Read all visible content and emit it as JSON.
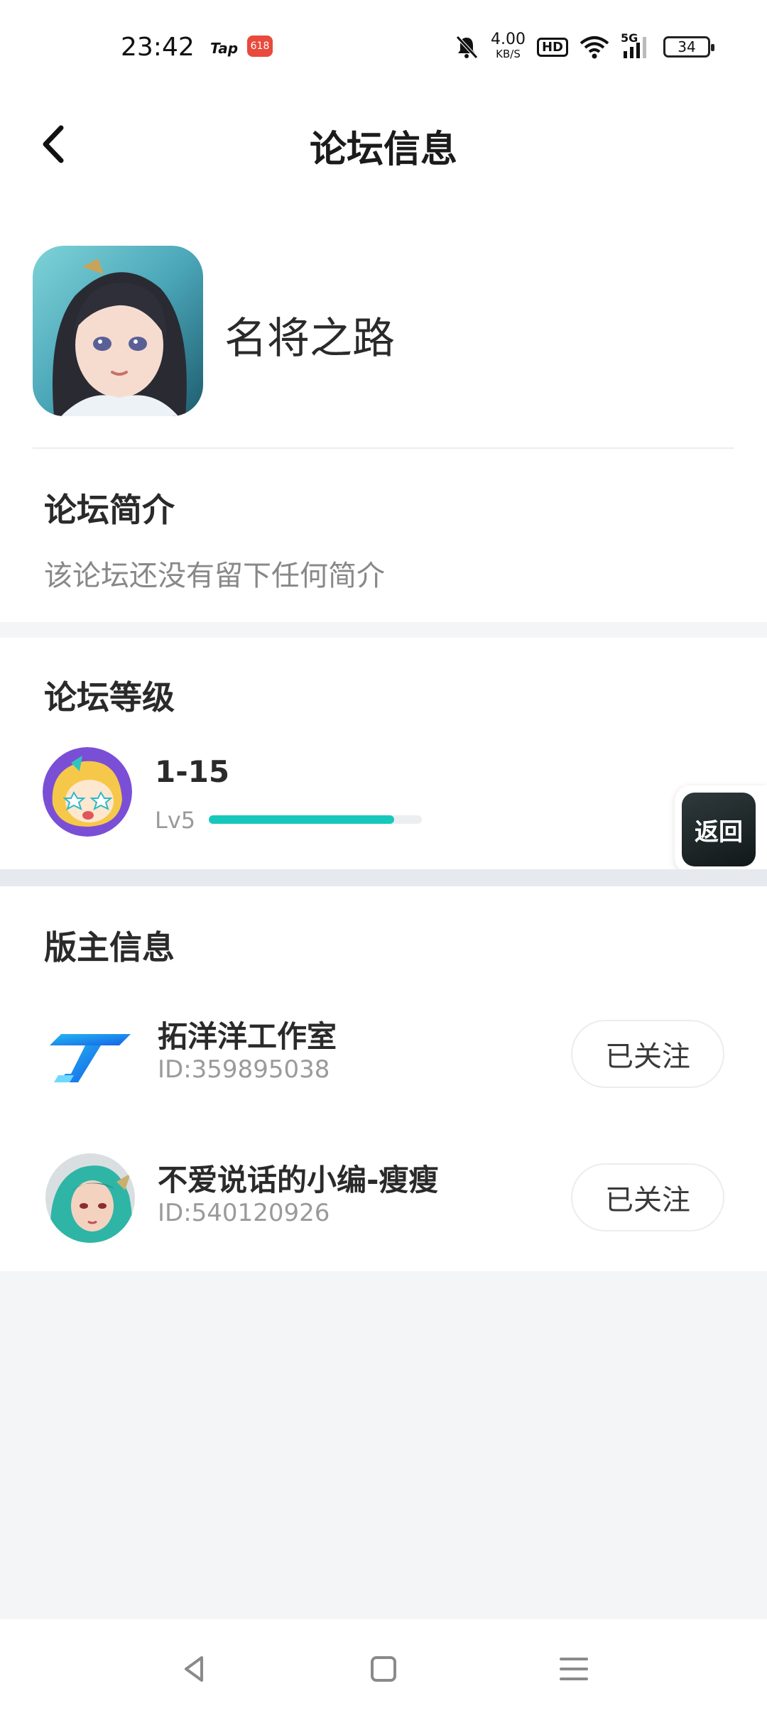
{
  "status_bar": {
    "time": "23:42",
    "app_badge_tap": "Tap",
    "app_badge_618": "618",
    "net_speed_value": "4.00",
    "net_speed_unit": "KB/S",
    "hd_label": "HD",
    "network_label": "5G",
    "battery": "34",
    "icons": [
      "mute-icon",
      "wifi-icon",
      "signal-icon",
      "battery-icon"
    ]
  },
  "header": {
    "title": "论坛信息",
    "back_icon": "chevron-left-icon"
  },
  "forum": {
    "name": "名将之路",
    "intro_title": "论坛简介",
    "intro_text": "该论坛还没有留下任何简介"
  },
  "level": {
    "title": "论坛等级",
    "range": "1-15",
    "level_label": "Lv5",
    "progress": 0.87,
    "progress_color": "#18c7bb"
  },
  "floating": {
    "return_label": "返回"
  },
  "moderators": {
    "title": "版主信息",
    "items": [
      {
        "name": "拓洋洋工作室",
        "id": "ID:359895038",
        "follow_label": "已关注"
      },
      {
        "name": "不爱说话的小编-瘦瘦",
        "id": "ID:540120926",
        "follow_label": "已关注"
      }
    ]
  },
  "nav": {
    "icons": [
      "back-triangle-icon",
      "home-square-icon",
      "menu-lines-icon"
    ]
  }
}
